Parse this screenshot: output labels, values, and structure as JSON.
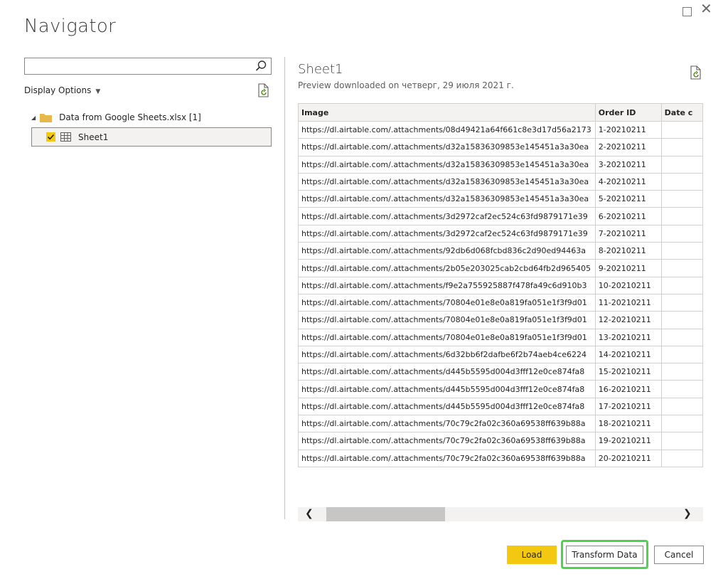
{
  "window": {
    "title": "Navigator",
    "maximize_symbol": "",
    "close_symbol": "✕"
  },
  "left_pane": {
    "search": {
      "value": "",
      "placeholder": ""
    },
    "display_options_label": "Display Options",
    "tree": {
      "folder_label": "Data from Google Sheets.xlsx [1]",
      "sheet_label": "Sheet1",
      "sheet_checked": true
    }
  },
  "preview": {
    "title": "Sheet1",
    "subtitle": "Preview downloaded on четверг, 29 июля 2021 г.",
    "columns": [
      "Image",
      "Order ID",
      "Date c"
    ],
    "rows": [
      [
        "https://dl.airtable.com/.attachments/08d49421a64f661c8e3d17d56a2173",
        "1-20210211",
        ""
      ],
      [
        "https://dl.airtable.com/.attachments/d32a15836309853e145451a3a30ea",
        "2-20210211",
        ""
      ],
      [
        "https://dl.airtable.com/.attachments/d32a15836309853e145451a3a30ea",
        "3-20210211",
        ""
      ],
      [
        "https://dl.airtable.com/.attachments/d32a15836309853e145451a3a30ea",
        "4-20210211",
        ""
      ],
      [
        "https://dl.airtable.com/.attachments/d32a15836309853e145451a3a30ea",
        "5-20210211",
        ""
      ],
      [
        "https://dl.airtable.com/.attachments/3d2972caf2ec524c63fd9879171e39",
        "6-20210211",
        ""
      ],
      [
        "https://dl.airtable.com/.attachments/3d2972caf2ec524c63fd9879171e39",
        "7-20210211",
        ""
      ],
      [
        "https://dl.airtable.com/.attachments/92db6d068fcbd836c2d90ed94463a",
        "8-20210211",
        ""
      ],
      [
        "https://dl.airtable.com/.attachments/2b05e203025cab2cbd64fb2d965405",
        "9-20210211",
        ""
      ],
      [
        "https://dl.airtable.com/.attachments/f9e2a755925887f478fa49c6d910b3",
        "10-20210211",
        ""
      ],
      [
        "https://dl.airtable.com/.attachments/70804e01e8e0a819fa051e1f3f9d01",
        "11-20210211",
        ""
      ],
      [
        "https://dl.airtable.com/.attachments/70804e01e8e0a819fa051e1f3f9d01",
        "12-20210211",
        ""
      ],
      [
        "https://dl.airtable.com/.attachments/70804e01e8e0a819fa051e1f3f9d01",
        "13-20210211",
        ""
      ],
      [
        "https://dl.airtable.com/.attachments/6d32bb6f2dafbe6f2b74aeb4ce6224",
        "14-20210211",
        ""
      ],
      [
        "https://dl.airtable.com/.attachments/d445b5595d004d3fff12e0ce874fa8",
        "15-20210211",
        ""
      ],
      [
        "https://dl.airtable.com/.attachments/d445b5595d004d3fff12e0ce874fa8",
        "16-20210211",
        ""
      ],
      [
        "https://dl.airtable.com/.attachments/d445b5595d004d3fff12e0ce874fa8",
        "17-20210211",
        ""
      ],
      [
        "https://dl.airtable.com/.attachments/70c79c2fa02c360a69538ff639b88a",
        "18-20210211",
        ""
      ],
      [
        "https://dl.airtable.com/.attachments/70c79c2fa02c360a69538ff639b88a",
        "19-20210211",
        ""
      ],
      [
        "https://dl.airtable.com/.attachments/70c79c2fa02c360a69538ff639b88a",
        "20-20210211",
        ""
      ]
    ],
    "scroll": {
      "left_arrow": "❮",
      "right_arrow": "❯"
    }
  },
  "footer": {
    "load_label": "Load",
    "transform_label": "Transform Data",
    "cancel_label": "Cancel"
  },
  "colors": {
    "accent": "#f2c811",
    "highlight": "#4bd44b",
    "folder": "#e8b84a"
  },
  "icons": [
    "maximize-icon",
    "close-icon",
    "search-icon",
    "chevron-down-icon",
    "refresh-icon",
    "expand-triangle-icon",
    "folder-icon",
    "checkbox-icon",
    "table-icon",
    "scroll-left-icon",
    "scroll-right-icon"
  ]
}
